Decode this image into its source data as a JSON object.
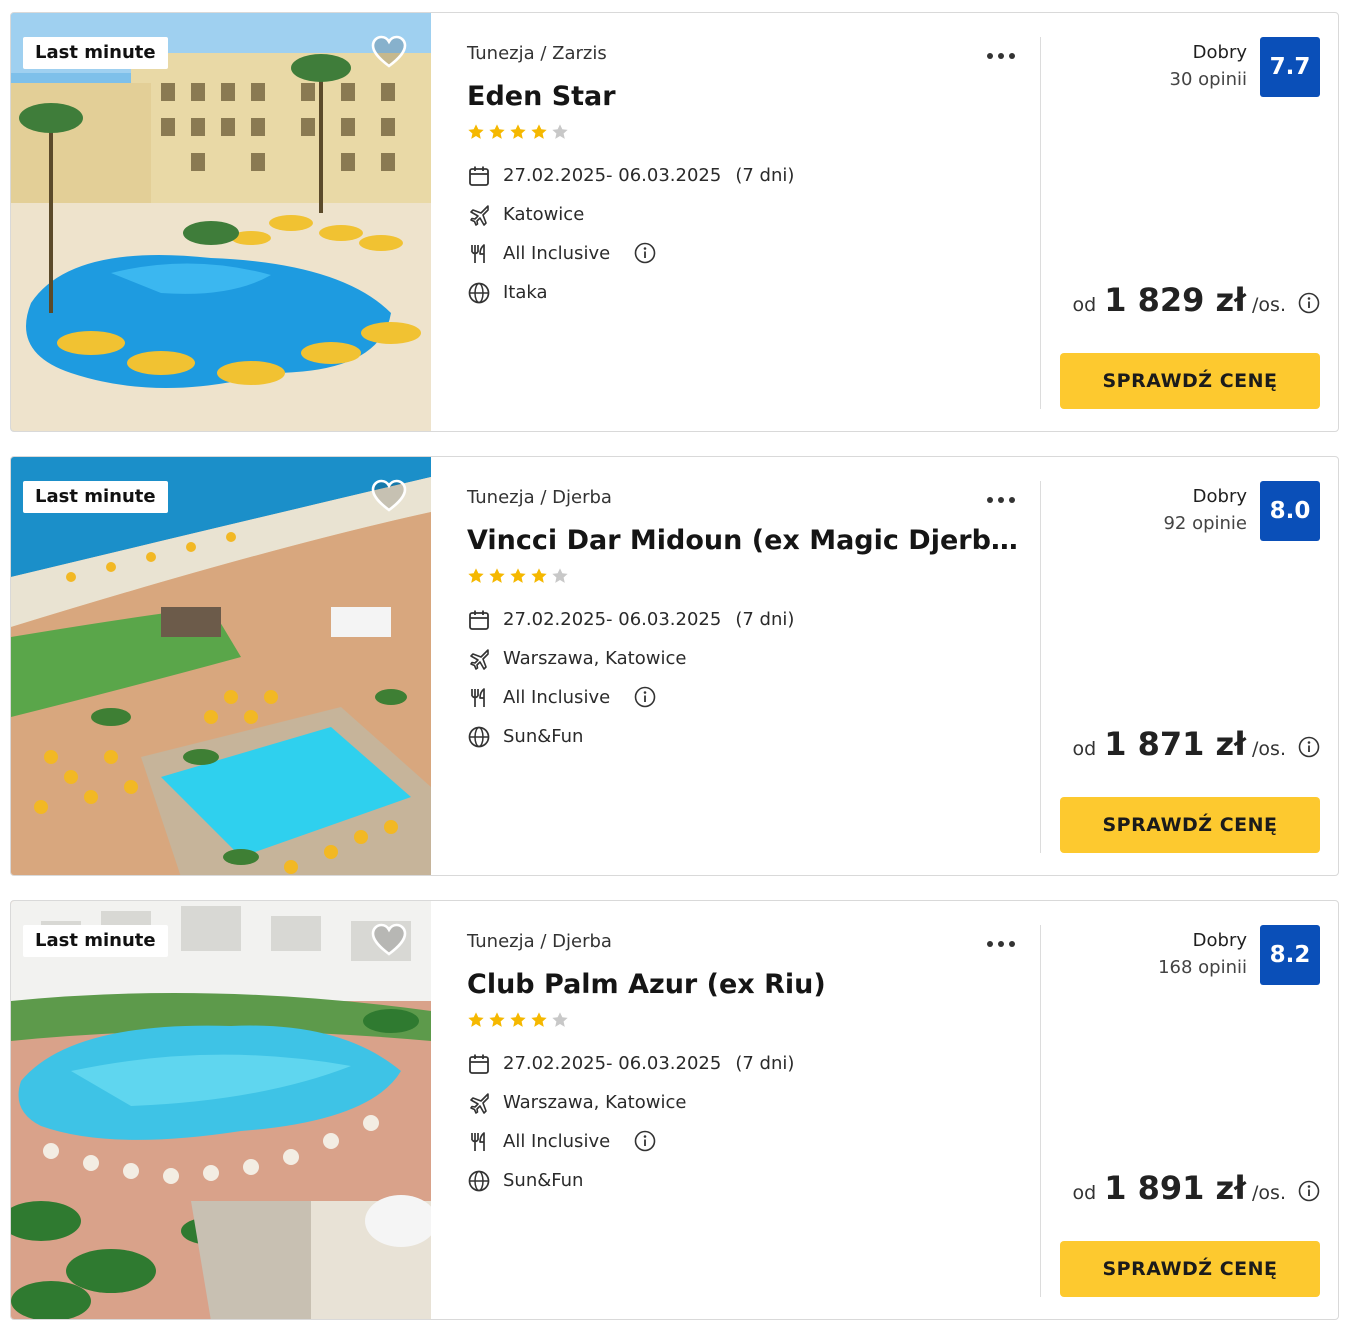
{
  "colors": {
    "accent_button": "#fdc92f",
    "score_badge": "#0a4fb8",
    "star_filled": "#f5b800",
    "star_empty": "#c8c8c8"
  },
  "labels": {
    "badge": "Last minute",
    "price_prefix": "od",
    "price_suffix": "/os.",
    "cta": "SPRAWDŹ CENĘ"
  },
  "offers": [
    {
      "location": "Tunezja / Zarzis",
      "name": "Eden Star",
      "stars": 4,
      "max_stars": 5,
      "dates": "27.02.2025- 06.03.2025",
      "duration": "(7 dni)",
      "departure": "Katowice",
      "board": "All Inclusive",
      "operator": "Itaka",
      "rating_word": "Dobry",
      "reviews": "30 opinii",
      "score": "7.7",
      "price": "1 829 zł",
      "photo_icon": "hotel-pool-photo"
    },
    {
      "location": "Tunezja / Djerba",
      "name": "Vincci Dar Midoun (ex Magic Djerba M...",
      "stars": 4,
      "max_stars": 5,
      "dates": "27.02.2025- 06.03.2025",
      "duration": "(7 dni)",
      "departure": "Warszawa, Katowice",
      "board": "All Inclusive",
      "operator": "Sun&Fun",
      "rating_word": "Dobry",
      "reviews": "92 opinie",
      "score": "8.0",
      "price": "1 871 zł",
      "photo_icon": "beach-resort-photo"
    },
    {
      "location": "Tunezja / Djerba",
      "name": "Club Palm Azur (ex Riu)",
      "stars": 4,
      "max_stars": 5,
      "dates": "27.02.2025- 06.03.2025",
      "duration": "(7 dni)",
      "departure": "Warszawa, Katowice",
      "board": "All Inclusive",
      "operator": "Sun&Fun",
      "rating_word": "Dobry",
      "reviews": "168 opinii",
      "score": "8.2",
      "price": "1 891 zł",
      "photo_icon": "resort-pool-photo"
    }
  ]
}
